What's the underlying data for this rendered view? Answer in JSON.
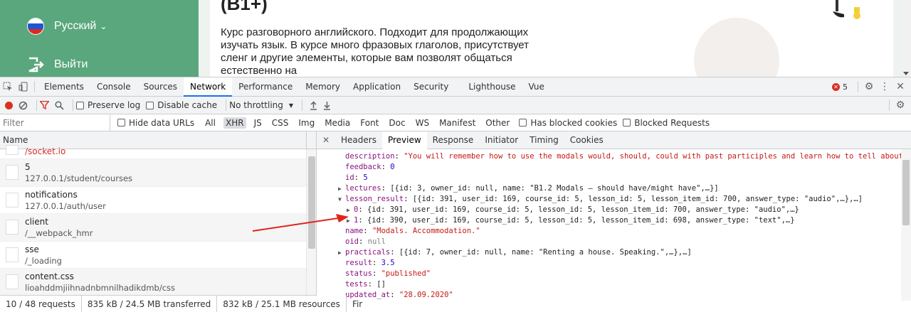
{
  "page": {
    "language": "Русский",
    "logout": "Выйти",
    "course_title": "(B1+)",
    "course_description": "Курс разговорного английского. Подходит для продолжающих изучать язык. В курсе много фразовых глаголов, присутствует сленг и другие элементы, которые вам позволят общаться естественно на"
  },
  "devtools": {
    "tabs": [
      "Elements",
      "Console",
      "Sources",
      "Network",
      "Performance",
      "Memory",
      "Application",
      "Security",
      "Lighthouse",
      "Vue"
    ],
    "active_tab": "Network",
    "error_count": "5",
    "toolbar": {
      "preserve_log": "Preserve log",
      "disable_cache": "Disable cache",
      "throttling": "No throttling"
    },
    "filter": {
      "placeholder": "Filter",
      "hide_data_urls": "Hide data URLs",
      "types": [
        "All",
        "XHR",
        "JS",
        "CSS",
        "Img",
        "Media",
        "Font",
        "Doc",
        "WS",
        "Manifest",
        "Other"
      ],
      "active_type": "XHR",
      "has_blocked_cookies": "Has blocked cookies",
      "blocked_requests": "Blocked Requests"
    },
    "requests": {
      "column_name": "Name",
      "items": [
        {
          "name": "/socket.io",
          "path": ""
        },
        {
          "name": "5",
          "path": "127.0.0.1/student/courses"
        },
        {
          "name": "notifications",
          "path": "127.0.0.1/auth/user"
        },
        {
          "name": "client",
          "path": "/__webpack_hmr"
        },
        {
          "name": "sse",
          "path": "/_loading"
        },
        {
          "name": "content.css",
          "path": "lioahddmjiihnadnbmnilhadikdmb/css"
        }
      ]
    },
    "preview_tabs": [
      "Headers",
      "Preview",
      "Response",
      "Initiator",
      "Timing",
      "Cookies"
    ],
    "active_preview_tab": "Preview",
    "preview": {
      "description_key": "description",
      "description_val": "\"You will remember how to use the modals would, should, could with past participles and learn how to tell about",
      "feedback_key": "feedback",
      "feedback_val": "0",
      "id_key": "id",
      "id_val": "5",
      "lectures_key": "lectures",
      "lectures_val": "[{id: 3, owner_id: null, name: \"B1.2 Modals – should have/might have\",…}]",
      "lesson_result_key": "lesson_result",
      "lesson_result_val": "[{id: 391, user_id: 169, course_id: 5, lesson_id: 5, lesson_item_id: 700, answer_type: \"audio\",…},…]",
      "lr0_key": "0",
      "lr0_val": "{id: 391, user_id: 169, course_id: 5, lesson_id: 5, lesson_item_id: 700, answer_type: \"audio\",…}",
      "lr1_key": "1",
      "lr1_val": "{id: 390, user_id: 169, course_id: 5, lesson_id: 5, lesson_item_id: 698, answer_type: \"text\",…}",
      "name_key": "name",
      "name_val": "\"Modals. Accommodation.\"",
      "oid_key": "oid",
      "oid_val": "null",
      "practicals_key": "practicals",
      "practicals_val": "[{id: 7, owner_id: null, name: \"Renting a house. Speaking.\",…},…]",
      "result_key": "result",
      "result_val": "3.5",
      "status_key": "status",
      "status_val": "\"published\"",
      "tests_key": "tests",
      "tests_val": "[]",
      "updated_at_key": "updated_at",
      "updated_at_val": "\"28.09.2020\""
    },
    "status_bar": {
      "requests": "10 / 48 requests",
      "transferred": "835 kB / 24.5 MB transferred",
      "resources": "832 kB / 25.1 MB resources",
      "finish": "Fir"
    }
  }
}
